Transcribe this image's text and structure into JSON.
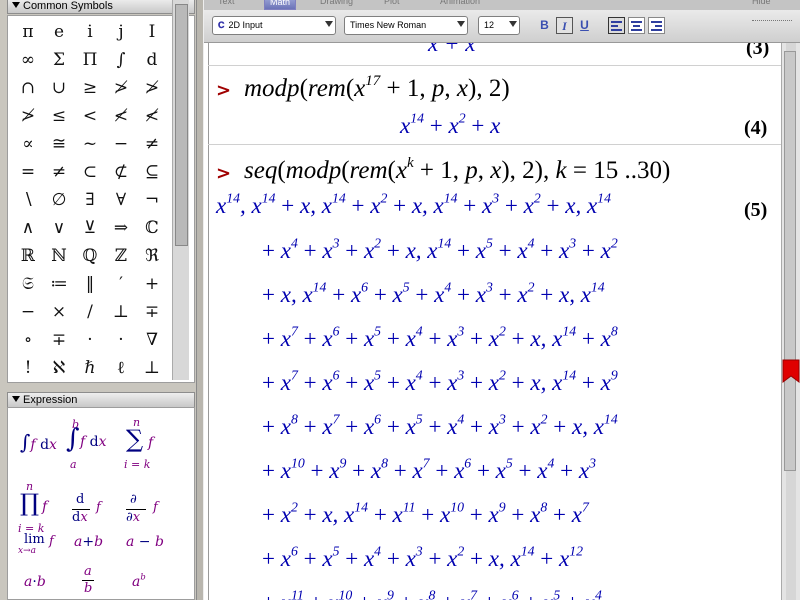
{
  "tabs": {
    "text": "Text",
    "math": "Math",
    "drawing": "Drawing",
    "plot": "Plot",
    "animation": "Animation",
    "hide": "Hide"
  },
  "toolbar": {
    "mode": "2D Input",
    "font": "Times New Roman",
    "size": "12",
    "bold": "B",
    "italic": "I",
    "underline": "U"
  },
  "palettes": {
    "symbols_title": "Common Symbols",
    "expression_title": "Expression",
    "symbols": [
      [
        "π",
        "e",
        "i",
        "j",
        "I"
      ],
      [
        "∞",
        "Σ",
        "Π",
        "∫",
        "d"
      ],
      [
        "∩",
        "∪",
        "≥",
        "≯",
        "≯"
      ],
      [
        "≯",
        "≤",
        "<",
        "≮",
        "≮"
      ],
      [
        "∝",
        "≅",
        "~",
        "−",
        "≠"
      ],
      [
        "=",
        "≠",
        "⊂",
        "⊄",
        "⊆"
      ],
      [
        "∖",
        "∅",
        "∃",
        "∀",
        "¬"
      ],
      [
        "∧",
        "∨",
        "⊻",
        "⇒",
        "ℂ"
      ],
      [
        "ℝ",
        "ℕ",
        "ℚ",
        "ℤ",
        "ℜ"
      ],
      [
        "𝔖",
        "≔",
        "‖",
        "′",
        "+"
      ],
      [
        "−",
        "×",
        "/",
        "⊥",
        "∓"
      ],
      [
        "∘",
        "∓",
        "·",
        "·",
        "∇"
      ],
      [
        "!",
        "ℵ",
        "ℏ",
        "ℓ",
        "⊥"
      ]
    ]
  },
  "worksheet": {
    "top_partial": "x + x",
    "top_label": "(3)",
    "input1": "modp(rem(x^17 + 1, p, x), 2)",
    "output1": "x^14 + x^2 + x",
    "label1": "(4)",
    "input2": "seq(modp(rem(x^k + 1, p, x), 2), k = 15 ..30)",
    "range_text": "15 ..30",
    "label2": "(5)"
  },
  "colors": {
    "prompt": "#a00000",
    "output": "#0000b0",
    "expression": "#800080"
  }
}
